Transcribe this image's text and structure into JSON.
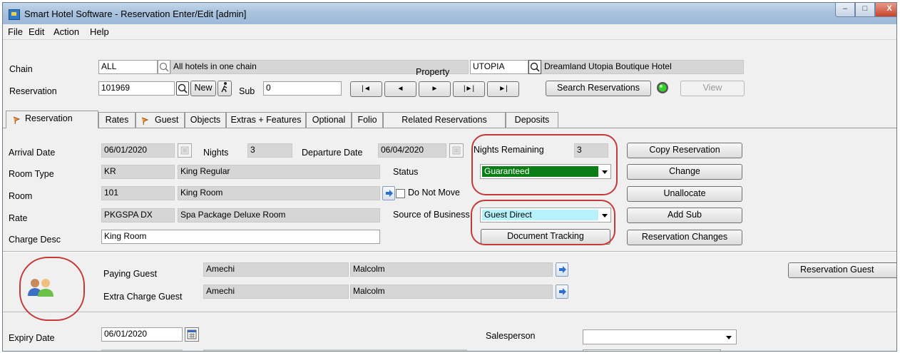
{
  "window": {
    "title": "Smart Hotel Software - Reservation Enter/Edit [admin]",
    "min": "–",
    "max": "□",
    "close": "X"
  },
  "menu": [
    "File",
    "Edit",
    "Action",
    "Help"
  ],
  "header": {
    "chain_label": "Chain",
    "chain_code": "ALL",
    "chain_name": "All hotels in one chain",
    "property_label": "Property",
    "property_code": "UTOPIA",
    "property_name": "Dreamland Utopia Boutique Hotel",
    "reservation_label": "Reservation",
    "reservation_no": "101969",
    "new_label": "New",
    "sub_label": "Sub",
    "sub_value": "0",
    "nav_first": "|◄",
    "nav_prev": "◄",
    "nav_next": "►",
    "nav_next_page": "|►|",
    "nav_last": "►|",
    "search_label": "Search Reservations",
    "view_label": "View"
  },
  "tabs": [
    "Reservation",
    "Rates",
    "Guest",
    "Objects",
    "Extras + Features",
    "Optional",
    "Folio",
    "Related Reservations",
    "Deposits"
  ],
  "reservation": {
    "arrival_label": "Arrival Date",
    "arrival": "06/01/2020",
    "nights_label": "Nights",
    "nights": "3",
    "departure_label": "Departure Date",
    "departure": "06/04/2020",
    "nights_remaining_label": "Nights Remaining",
    "nights_remaining": "3",
    "room_type_label": "Room Type",
    "room_type_code": "KR",
    "room_type_name": "King Regular",
    "status_label": "Status",
    "status": "Guaranteed",
    "room_label": "Room",
    "room_no": "101",
    "room_name": "King Room",
    "do_not_move_label": "Do Not Move",
    "rate_label": "Rate",
    "rate_code": "PKGSPA DX",
    "rate_name": "Spa Package Deluxe Room",
    "source_label": "Source of Business",
    "source": "Guest Direct",
    "charge_desc_label": "Charge Desc",
    "charge_desc": "King Room",
    "doc_tracking": "Document Tracking"
  },
  "actions": [
    "Copy Reservation",
    "Change",
    "Unallocate",
    "Add Sub",
    "Reservation Changes"
  ],
  "guests": {
    "paying_label": "Paying Guest",
    "paying_last": "Amechi",
    "paying_first": "Malcolm",
    "extra_label": "Extra Charge Guest",
    "extra_last": "Amechi",
    "extra_first": "Malcolm",
    "reservation_guest": "Reservation Guest"
  },
  "bottom": {
    "expiry_label": "Expiry Date",
    "expiry": "06/01/2020",
    "salesperson_label": "Salesperson",
    "salesperson": ""
  },
  "colors": {
    "status_bg": "#0a7d16",
    "source_bg": "#b6f2fb",
    "annotation": "#c43a3a"
  }
}
